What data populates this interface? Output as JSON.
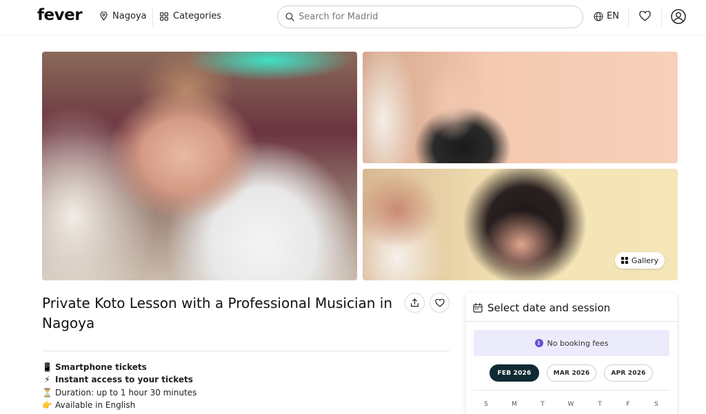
{
  "header": {
    "logo": "fever",
    "city": "Nagoya",
    "categories_label": "Categories",
    "search_placeholder": "Search for Madrid",
    "language": "EN",
    "icons": [
      "location-pin-icon",
      "grid-icon",
      "search-icon",
      "globe-icon",
      "heart-icon",
      "user-icon"
    ]
  },
  "gallery": {
    "button_label": "Gallery"
  },
  "event": {
    "title": "Private Koto Lesson with a Professional Musician in Nagoya",
    "features": [
      {
        "icon": "📱",
        "text": "Smartphone tickets",
        "bold": true
      },
      {
        "icon": "⚡",
        "text": "Instant access to your tickets",
        "bold": true
      },
      {
        "icon": "⏳",
        "text": "Duration: up to 1 hour 30 minutes",
        "bold": false
      },
      {
        "icon": "👉",
        "text": "Available in English",
        "bold": false
      }
    ]
  },
  "booking": {
    "heading": "Select date and session",
    "fees_notice": "No booking fees",
    "months": [
      {
        "label": "FEB 2026",
        "active": true
      },
      {
        "label": "MAR 2026",
        "active": false
      },
      {
        "label": "APR 2026",
        "active": false
      }
    ],
    "weekdays": [
      "S",
      "M",
      "T",
      "W",
      "T",
      "F",
      "S"
    ]
  },
  "colors": {
    "accent_dark": "#0f2a33",
    "notice_bg": "#ecebfb",
    "info_icon": "#6b4fd1"
  }
}
